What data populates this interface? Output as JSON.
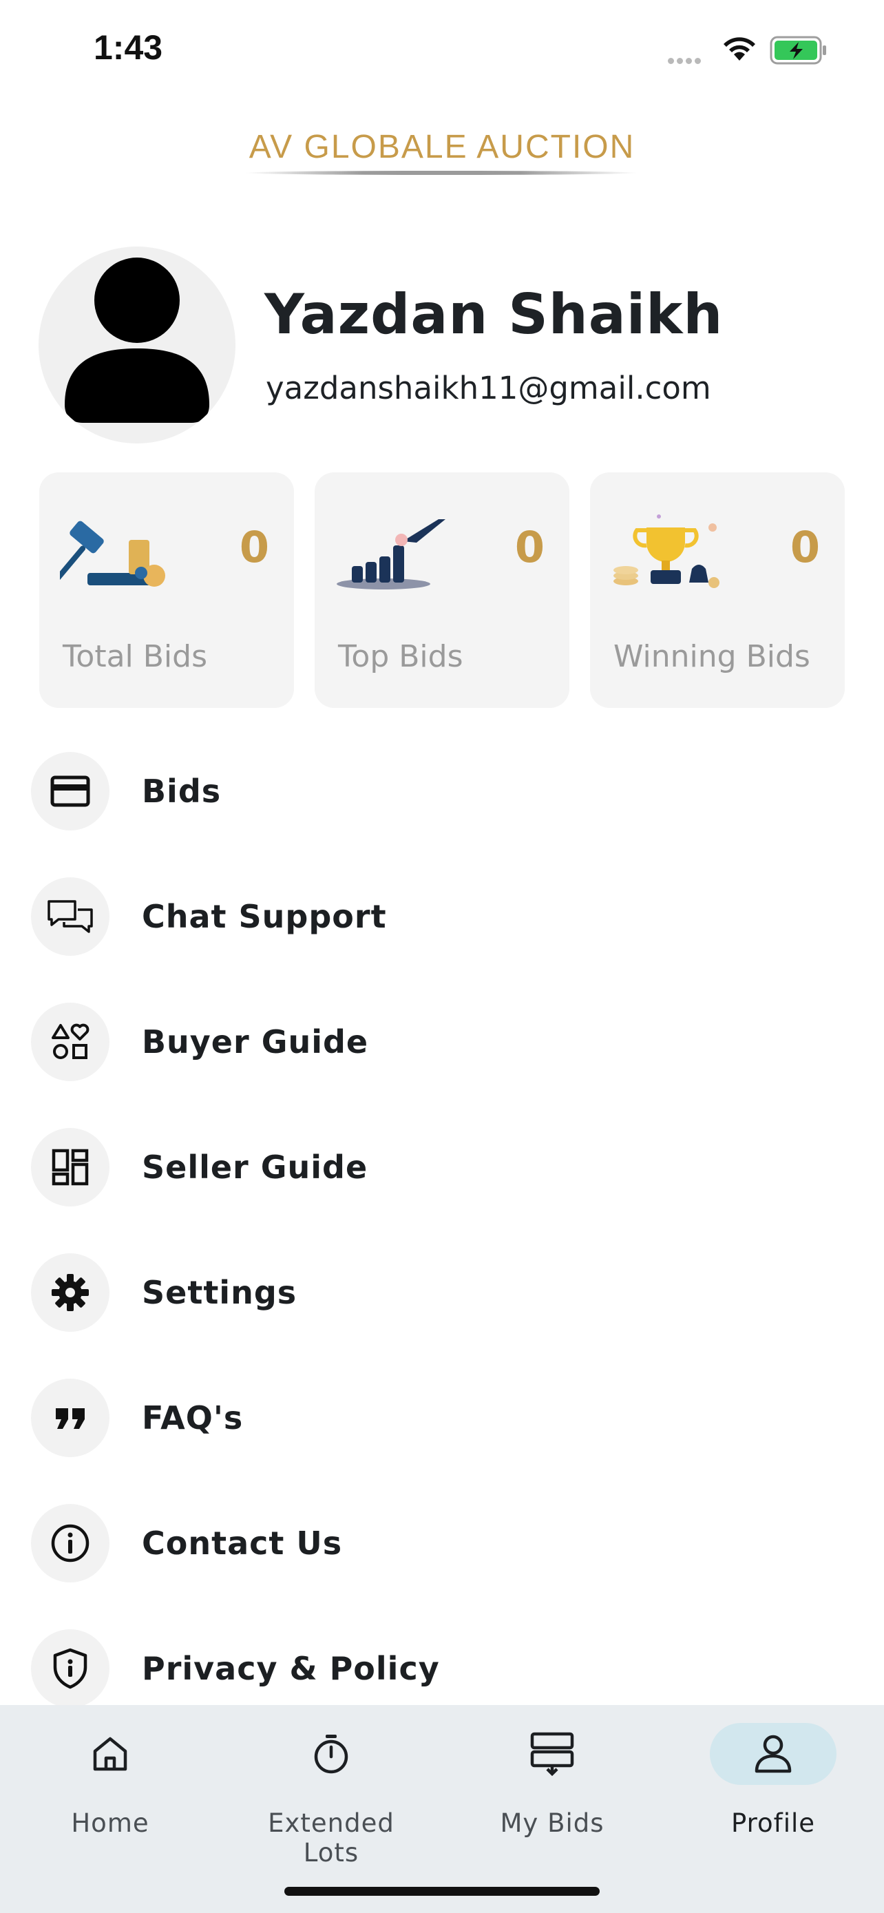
{
  "status_bar": {
    "time": "1:43",
    "icons": [
      "signal-dots-icon",
      "wifi-icon",
      "battery-charging-icon"
    ]
  },
  "brand": {
    "title": "AV GLOBALE AUCTION",
    "color": "#c79b4a"
  },
  "profile": {
    "name": "Yazdan Shaikh",
    "email": "yazdanshaikh11@gmail.com"
  },
  "stats": [
    {
      "label": "Total Bids",
      "value": "0",
      "icon": "gavel-coins-icon"
    },
    {
      "label": "Top Bids",
      "value": "0",
      "icon": "coin-stacks-icon"
    },
    {
      "label": "Winning Bids",
      "value": "0",
      "icon": "trophy-icon"
    }
  ],
  "menu": [
    {
      "label": "Bids",
      "icon": "card-icon"
    },
    {
      "label": "Chat Support",
      "icon": "chat-bubbles-icon"
    },
    {
      "label": "Buyer Guide",
      "icon": "shapes-icon"
    },
    {
      "label": "Seller Guide",
      "icon": "dashboard-icon"
    },
    {
      "label": "Settings",
      "icon": "gear-icon"
    },
    {
      "label": "FAQ's",
      "icon": "quote-icon"
    },
    {
      "label": "Contact Us",
      "icon": "info-icon"
    },
    {
      "label": "Privacy & Policy",
      "icon": "shield-icon"
    }
  ],
  "bottom_nav": [
    {
      "label": "Home",
      "icon": "home-icon",
      "active": false
    },
    {
      "label": "Extended Lots",
      "icon": "stopwatch-icon",
      "active": false
    },
    {
      "label": "My Bids",
      "icon": "stack-download-icon",
      "active": false
    },
    {
      "label": "Profile",
      "icon": "person-icon",
      "active": true
    }
  ],
  "colors": {
    "accent": "#c79b4a",
    "nav_bg": "#e9edf0",
    "active_pill": "#d2e7ee"
  }
}
